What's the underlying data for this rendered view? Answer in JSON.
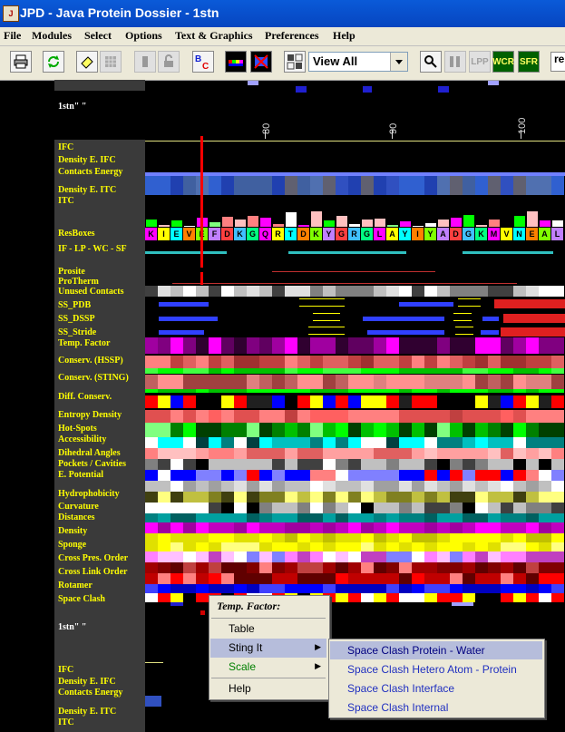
{
  "window": {
    "title": "JPD - Java Protein Dossier - 1stn",
    "icon": "jpd-app-icon"
  },
  "menu": [
    "File",
    "Modules",
    "Select",
    "Options",
    "Text & Graphics",
    "Preferences",
    "Help"
  ],
  "toolbar": {
    "buttons": [
      {
        "name": "print-icon",
        "label": ""
      },
      {
        "name": "refresh-icon",
        "label": ""
      },
      {
        "name": "eraser-icon",
        "label": ""
      },
      {
        "name": "grid-icon",
        "label": ""
      },
      {
        "name": "clipboard-icon",
        "label": ""
      },
      {
        "name": "lock-icon",
        "label": ""
      },
      {
        "name": "bc-icon",
        "label": "BC"
      },
      {
        "name": "palette-icon",
        "label": ""
      },
      {
        "name": "no-palette-icon",
        "label": ""
      },
      {
        "name": "layout-icon",
        "label": ""
      }
    ],
    "view_select": "View All",
    "right_buttons": [
      {
        "name": "zoom-icon",
        "label": ""
      },
      {
        "name": "columns-icon",
        "label": ""
      },
      {
        "name": "lpp-icon",
        "label": "LPP"
      },
      {
        "name": "wcr-icon",
        "label": "WCR"
      },
      {
        "name": "sfr-icon",
        "label": "SFR"
      }
    ],
    "right_edge_text": "re"
  },
  "panel": {
    "chain_label": "1stn\"  \"",
    "chain_label_2": "1stn\"  \"",
    "ticks": [
      "80",
      "90",
      "100"
    ],
    "tracks": [
      "IFC",
      "Density E. IFC",
      "Contacts Energy",
      "Density E. ITC",
      "ITC",
      "ResBoxes",
      "IF - LP - WC - SF",
      "Prosite",
      "ProTherm",
      "Unused Contacts",
      "SS_PDB",
      "SS_DSSP",
      "SS_Stride",
      "Temp. Factor",
      "Conserv. (HSSP)",
      "Conserv. (STING)",
      "Diff. Conserv.",
      "Entropy Density",
      "Hot-Spots",
      "Accessibility",
      "Dihedral Angles",
      "Pockets / Cavities",
      "E. Potential",
      "Hydrophobicity",
      "Curvature",
      "Distances",
      "Density",
      "Sponge",
      "Cross Pres. Order",
      "Cross Link Order",
      "Rotamer",
      "Space Clash"
    ],
    "tracks_2": [
      "IFC",
      "Density E. IFC",
      "Contacts Energy",
      "Density E. ITC",
      "ITC"
    ],
    "sequence": [
      "K",
      "I",
      "E",
      "V",
      "E",
      "F",
      "D",
      "K",
      "G",
      "Q",
      "R",
      "T",
      "D",
      "K",
      "Y",
      "G",
      "R",
      "G",
      "L",
      "A",
      "Y",
      "I",
      "Y",
      "A",
      "D",
      "G",
      "K",
      "M",
      "V",
      "N",
      "E",
      "A",
      "L"
    ]
  },
  "context_menu": {
    "header": "Temp. Factor:",
    "items": [
      {
        "label": "Table",
        "has_submenu": false,
        "color": "#000000"
      },
      {
        "label": "Sting It",
        "has_submenu": true,
        "color": "#000000"
      },
      {
        "label": "Scale",
        "has_submenu": true,
        "color": "#008000"
      },
      {
        "label": "Help",
        "has_submenu": false,
        "color": "#000000"
      }
    ],
    "submenu_arrow": "▶"
  },
  "submenu": {
    "items": [
      "Space Clash Protein - Water",
      "Space Clash Hetero Atom - Protein",
      "Space Clash Interface",
      "Space Clash Internal"
    ]
  }
}
